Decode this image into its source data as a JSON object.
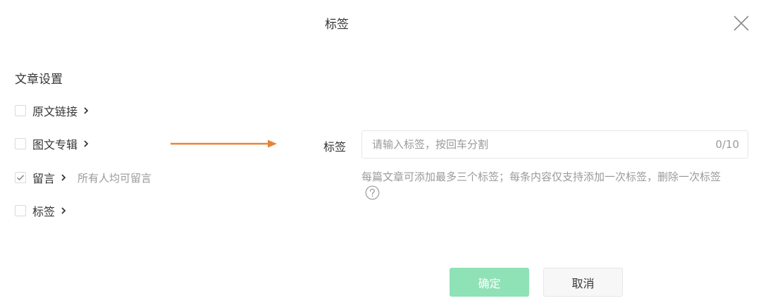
{
  "dialog": {
    "title": "标签"
  },
  "settings": {
    "section_title": "文章设置",
    "options": [
      {
        "label": "原文链接",
        "checked": false,
        "description": ""
      },
      {
        "label": "图文专辑",
        "checked": false,
        "description": ""
      },
      {
        "label": "留言",
        "checked": true,
        "description": "所有人均可留言"
      },
      {
        "label": "标签",
        "checked": false,
        "description": ""
      }
    ]
  },
  "tag_panel": {
    "label": "标签",
    "input_value": "",
    "input_placeholder": "请输入标签，按回车分割",
    "counter": "0/10",
    "tip": "每篇文章可添加最多三个标签；每条内容仅支持添加一次标签，删除一次标签"
  },
  "buttons": {
    "confirm": "确定",
    "cancel": "取消"
  },
  "colors": {
    "arrow": "#e8843a",
    "confirm_bg": "#8fe1b6",
    "text_primary": "#353535",
    "text_secondary": "#9a9a9a"
  },
  "icons": {
    "close": "close-icon",
    "chevron": "chevron-right-icon",
    "check": "check-icon",
    "help": "question-circle-icon"
  }
}
